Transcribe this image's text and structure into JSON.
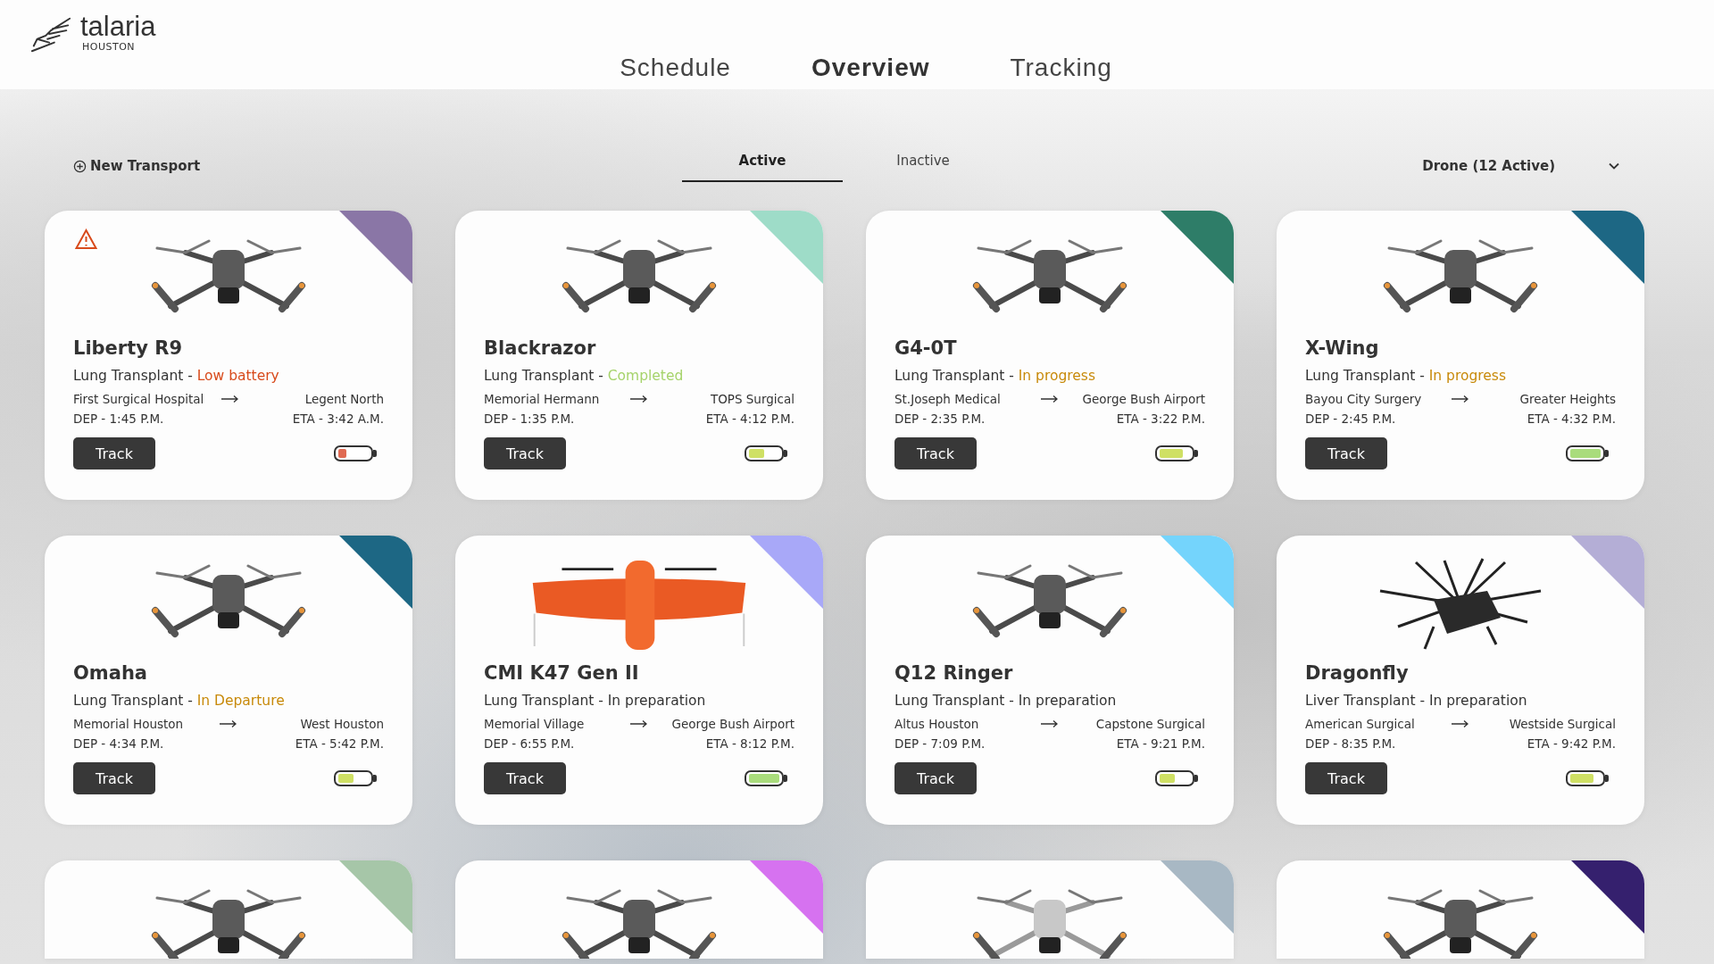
{
  "logo": {
    "name": "talaria",
    "city": "HOUSTON"
  },
  "nav": [
    {
      "label": "Schedule",
      "selected": false
    },
    {
      "label": "Overview",
      "selected": true
    },
    {
      "label": "Tracking",
      "selected": false
    }
  ],
  "new_transport": "New Transport",
  "tabs": [
    {
      "label": "Active",
      "selected": true
    },
    {
      "label": "Inactive",
      "selected": false
    }
  ],
  "filter": {
    "value": "Drone (12 Active)"
  },
  "cards": [
    {
      "kind": "full",
      "image": {
        "kind": "quad"
      },
      "color": "#8a76a6",
      "alert": true,
      "name": "Liberty R9",
      "mission": "Lung Transplant - ",
      "status": {
        "text": "Low battery",
        "kind": "low"
      },
      "from": "First Surgical Hospital",
      "to": "Legent North",
      "dep": "DEP - 1:45 P.M.",
      "eta": "ETA - 3:42 A.M.",
      "button": "Track",
      "battery": {
        "level": 0.25
      }
    },
    {
      "kind": "full",
      "image": {
        "kind": "quad"
      },
      "color": "#9edcc8",
      "alert": false,
      "name": "Blackrazor",
      "mission": "Lung Transplant - ",
      "status": {
        "text": "Completed",
        "kind": "completed"
      },
      "from": "Memorial Hermann",
      "to": "TOPS Surgical",
      "dep": "DEP - 1:35 P.M.",
      "eta": "ETA - 4:12 P.M.",
      "button": "Track",
      "battery": {
        "level": 0.5
      }
    },
    {
      "kind": "full",
      "image": {
        "kind": "quad"
      },
      "color": "#2e7d68",
      "alert": false,
      "name": "G4-0T",
      "mission": "Lung Transplant - ",
      "status": {
        "text": "In progress",
        "kind": "progress"
      },
      "from": "St.Joseph Medical",
      "to": "George Bush Airport",
      "dep": "DEP - 2:35 P.M.",
      "eta": "ETA - 3:22 P.M.",
      "button": "Track",
      "battery": {
        "level": 0.75
      }
    },
    {
      "kind": "full",
      "image": {
        "kind": "quad"
      },
      "color": "#1d6784",
      "alert": false,
      "name": "X-Wing",
      "mission": "Lung Transplant - ",
      "status": {
        "text": "In progress",
        "kind": "progress"
      },
      "from": "Bayou City Surgery",
      "to": "Greater Heights",
      "dep": "DEP - 2:45 P.M.",
      "eta": "ETA - 4:32 P.M.",
      "button": "Track",
      "battery": {
        "level": 1
      }
    },
    {
      "kind": "full",
      "image": {
        "kind": "quad"
      },
      "color": "#1d6784",
      "alert": false,
      "name": "Omaha",
      "mission": "Lung Transplant - ",
      "status": {
        "text": "In Departure",
        "kind": "progress"
      },
      "from": "Memorial Houston",
      "to": "West Houston",
      "dep": "DEP - 4:34 P.M.",
      "eta": "ETA - 5:42 P.M.",
      "button": "Track",
      "battery": {
        "level": 0.5
      }
    },
    {
      "kind": "full",
      "image": {
        "kind": "wing"
      },
      "color": "#a8a8f8",
      "alert": false,
      "name": "CMI K47 Gen II",
      "mission": "Lung Transplant - ",
      "status": {
        "text": "In preparation",
        "kind": "prep"
      },
      "from": "Memorial Village",
      "to": "George Bush Airport",
      "dep": "DEP - 6:55 P.M.",
      "eta": "ETA - 8:12 P.M.",
      "button": "Track",
      "battery": {
        "level": 1
      }
    },
    {
      "kind": "full",
      "image": {
        "kind": "quad"
      },
      "color": "#74d4fc",
      "alert": false,
      "name": "Q12 Ringer",
      "mission": "Lung Transplant - ",
      "status": {
        "text": "In preparation",
        "kind": "prep"
      },
      "from": "Altus Houston",
      "to": "Capstone Surgical",
      "dep": "DEP - 7:09 P.M.",
      "eta": "ETA - 9:21 P.M.",
      "button": "Track",
      "battery": {
        "level": 0.5
      }
    },
    {
      "kind": "full",
      "image": {
        "kind": "octo"
      },
      "color": "#b4aed6",
      "alert": false,
      "name": "Dragonfly",
      "mission": "Liver Transplant - ",
      "status": {
        "text": "In preparation",
        "kind": "prep"
      },
      "from": "American Surgical",
      "to": "Westside Surgical",
      "dep": "DEP - 8:35 P.M.",
      "eta": "ETA - 9:42 P.M.",
      "button": "Track",
      "battery": {
        "level": 0.75
      }
    },
    {
      "kind": "partial",
      "image": {
        "kind": "quad"
      },
      "color": "#a6c6a8"
    },
    {
      "kind": "partial",
      "image": {
        "kind": "quad"
      },
      "color": "#d672f0"
    },
    {
      "kind": "partial",
      "image": {
        "kind": "light"
      },
      "color": "#a8b8c4"
    },
    {
      "kind": "partial",
      "image": {
        "kind": "quad"
      },
      "color": "#35206e"
    }
  ]
}
